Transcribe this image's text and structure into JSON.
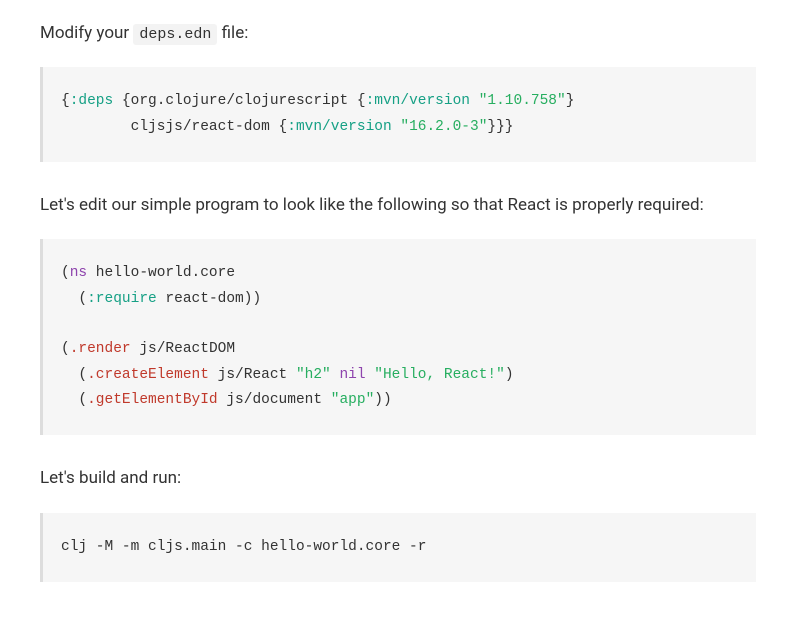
{
  "para1_pre": "Modify your ",
  "para1_code": "deps.edn",
  "para1_post": " file:",
  "code1": {
    "l1": {
      "a": "{",
      "b": ":deps",
      "c": " {org.clojure/clojurescript {",
      "d": ":mvn/version",
      "e": " ",
      "f": "\"1.10.758\"",
      "g": "}"
    },
    "l2": {
      "a": "        cljsjs/react-dom {",
      "b": ":mvn/version",
      "c": " ",
      "d": "\"16.2.0-3\"",
      "e": "}}}"
    }
  },
  "para2": "Let's edit our simple program to look like the following so that React is properly required:",
  "code2": {
    "l1": {
      "a": "(",
      "b": "ns",
      "c": " hello-world.core"
    },
    "l2": {
      "a": "  (",
      "b": ":require",
      "c": " react-dom))"
    },
    "l3": "",
    "l4": {
      "a": "(",
      "b": ".render",
      "c": " js/ReactDOM"
    },
    "l5": {
      "a": "  (",
      "b": ".createElement",
      "c": " js/React ",
      "d": "\"h2\"",
      "e": " ",
      "f": "nil",
      "g": " ",
      "h": "\"Hello, React!\"",
      "i": ")"
    },
    "l6": {
      "a": "  (",
      "b": ".getElementById",
      "c": " js/document ",
      "d": "\"app\"",
      "e": "))"
    }
  },
  "para3": "Let's build and run:",
  "code3": "clj -M -m cljs.main -c hello-world.core -r"
}
